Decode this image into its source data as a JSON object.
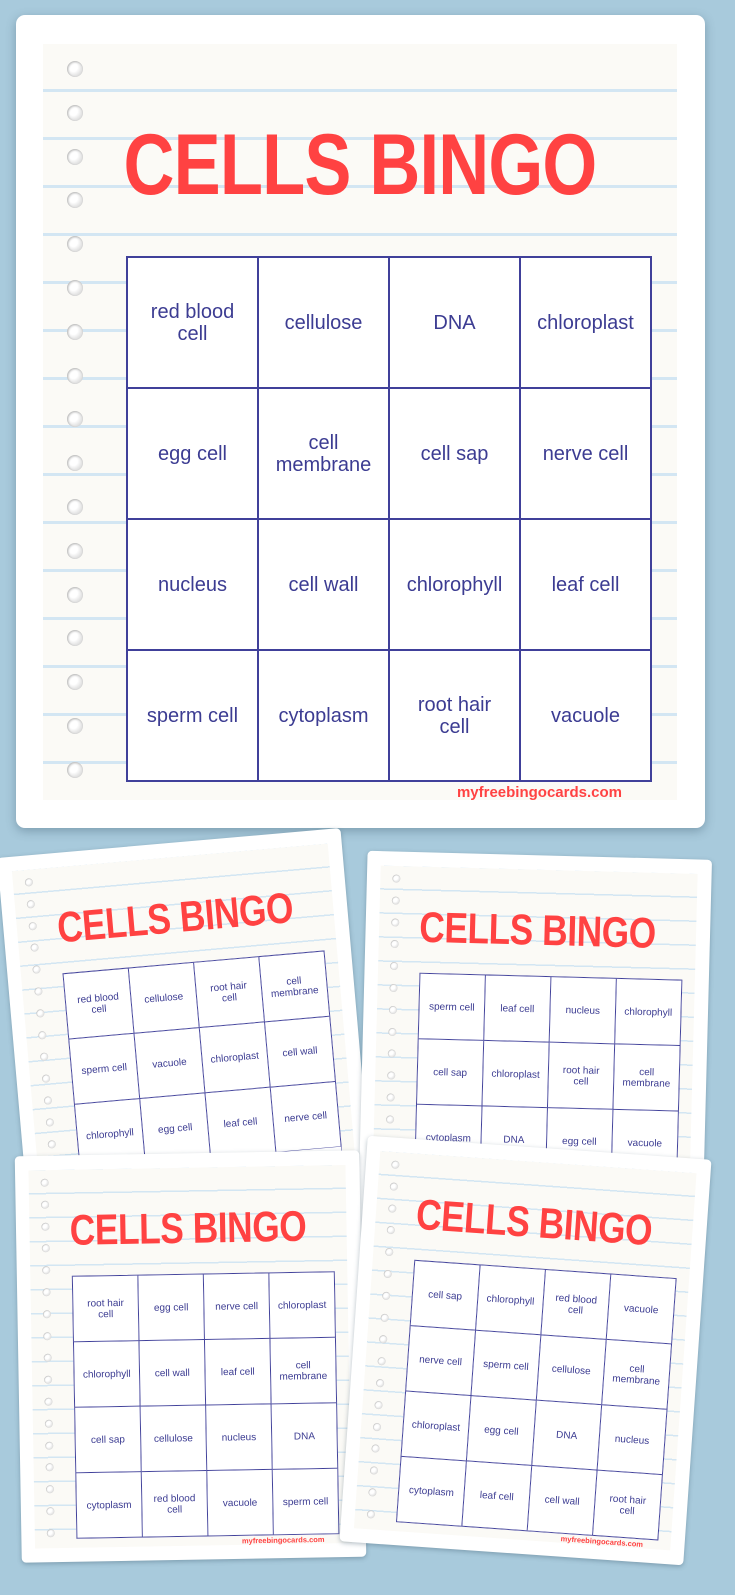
{
  "title": "CELLS BINGO",
  "site": "myfreebingocards.com",
  "colors": {
    "background": "#a8cadc",
    "title": "#ff4242",
    "grid": "#40409a",
    "text": "#3c3c92"
  },
  "cards": [
    {
      "cells": [
        "red blood cell",
        "cellulose",
        "DNA",
        "chloroplast",
        "egg cell",
        "cell membrane",
        "cell sap",
        "nerve cell",
        "nucleus",
        "cell wall",
        "chlorophyll",
        "leaf cell",
        "sperm cell",
        "cytoplasm",
        "root hair cell",
        "vacuole"
      ]
    },
    {
      "cells": [
        "red blood cell",
        "cellulose",
        "root hair cell",
        "cell membrane",
        "sperm cell",
        "vacuole",
        "chloroplast",
        "cell wall",
        "chlorophyll",
        "egg cell",
        "leaf cell",
        "nerve cell"
      ]
    },
    {
      "cells": [
        "sperm cell",
        "leaf cell",
        "nucleus",
        "chlorophyll",
        "cell sap",
        "chloroplast",
        "root hair cell",
        "cell membrane",
        "cytoplasm",
        "DNA",
        "egg cell",
        "vacuole"
      ]
    },
    {
      "cells": [
        "root hair cell",
        "egg cell",
        "nerve cell",
        "chloroplast",
        "chlorophyll",
        "cell wall",
        "leaf cell",
        "cell membrane",
        "cell sap",
        "cellulose",
        "nucleus",
        "DNA",
        "cytoplasm",
        "red blood cell",
        "vacuole",
        "sperm cell"
      ]
    },
    {
      "cells": [
        "cell sap",
        "chlorophyll",
        "red blood cell",
        "vacuole",
        "nerve cell",
        "sperm cell",
        "cellulose",
        "cell membrane",
        "chloroplast",
        "egg cell",
        "DNA",
        "nucleus",
        "cytoplasm",
        "leaf cell",
        "cell wall",
        "root hair cell"
      ]
    }
  ]
}
